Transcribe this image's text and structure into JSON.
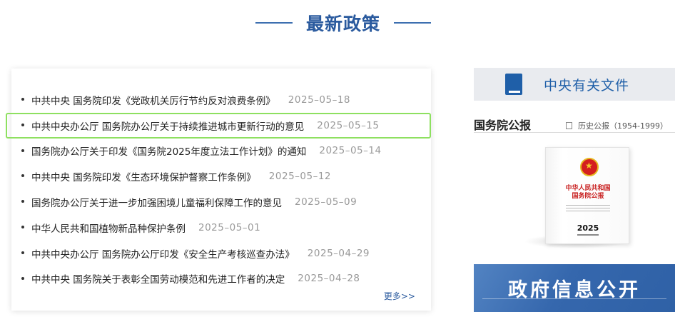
{
  "section": {
    "title": "最新政策"
  },
  "news": [
    {
      "title": "中共中央 国务院印发《党政机关厉行节约反对浪费条例》",
      "date": "2025–05–18"
    },
    {
      "title": "中共中央办公厅 国务院办公厅关于持续推进城市更新行动的意见",
      "date": "2025–05–15",
      "highlighted": true
    },
    {
      "title": "国务院办公厅关于印发《国务院2025年度立法工作计划》的通知",
      "date": "2025–05–14"
    },
    {
      "title": "中共中央 国务院印发《生态环境保护督察工作条例》",
      "date": "2025–05–12"
    },
    {
      "title": "国务院办公厅关于进一步加强困境儿童福利保障工作的意见",
      "date": "2025–05–09"
    },
    {
      "title": "中华人民共和国植物新品种保护条例",
      "date": "2025–05–01"
    },
    {
      "title": "中共中央办公厅 国务院办公厅印发《安全生产考核巡查办法》",
      "date": "2025–04–29"
    },
    {
      "title": "中共中央 国务院关于表彰全国劳动模范和先进工作者的决定",
      "date": "2025–04–28"
    }
  ],
  "more_label": "更多>>",
  "sidebar": {
    "central_docs_label": "中央有关文件",
    "central_docs_icon": "book-icon",
    "gazette_title": "国务院公报",
    "history_label": "历史公报（1954-1999）",
    "history_icon": "archive-icon",
    "cover": {
      "line1": "中华人民共和国",
      "line2": "国务院公报",
      "year": "2025"
    },
    "gov_info_label": "政府信息公开"
  },
  "colors": {
    "accent": "#2a5a9e",
    "highlight_outline": "#8ee060",
    "banner": "#3567ad"
  }
}
